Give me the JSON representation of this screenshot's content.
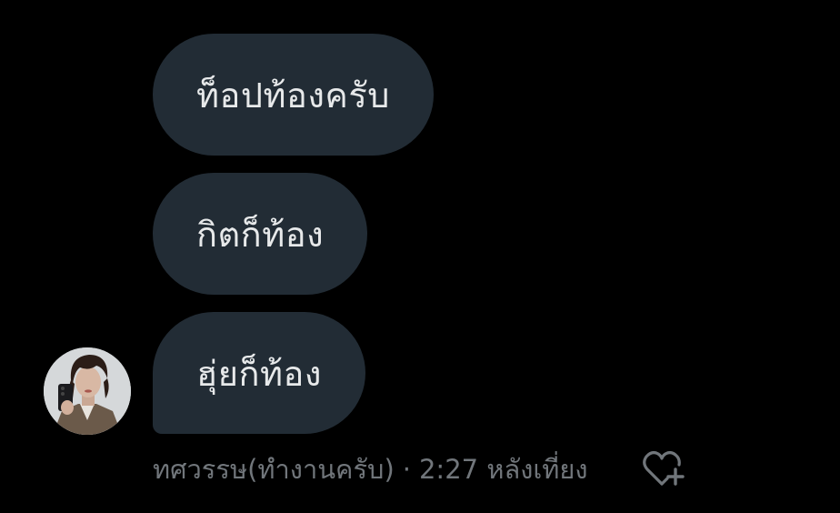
{
  "messages": [
    {
      "text": "ท็อปท้องครับ"
    },
    {
      "text": "กิตก็ท้อง"
    },
    {
      "text": "ฮุ่ยก็ท้อง"
    }
  ],
  "sender": {
    "name": "ทศวรรษ(ทำงานครับ)",
    "separator": "·",
    "timestamp": "2:27 หลังเที่ยง",
    "avatar_icon": "user-avatar-photo"
  },
  "actions": {
    "reaction_icon": "heart-plus-icon"
  },
  "colors": {
    "background": "#000000",
    "bubble": "#222c35",
    "text": "#e7e9ea",
    "muted": "#71767b"
  }
}
